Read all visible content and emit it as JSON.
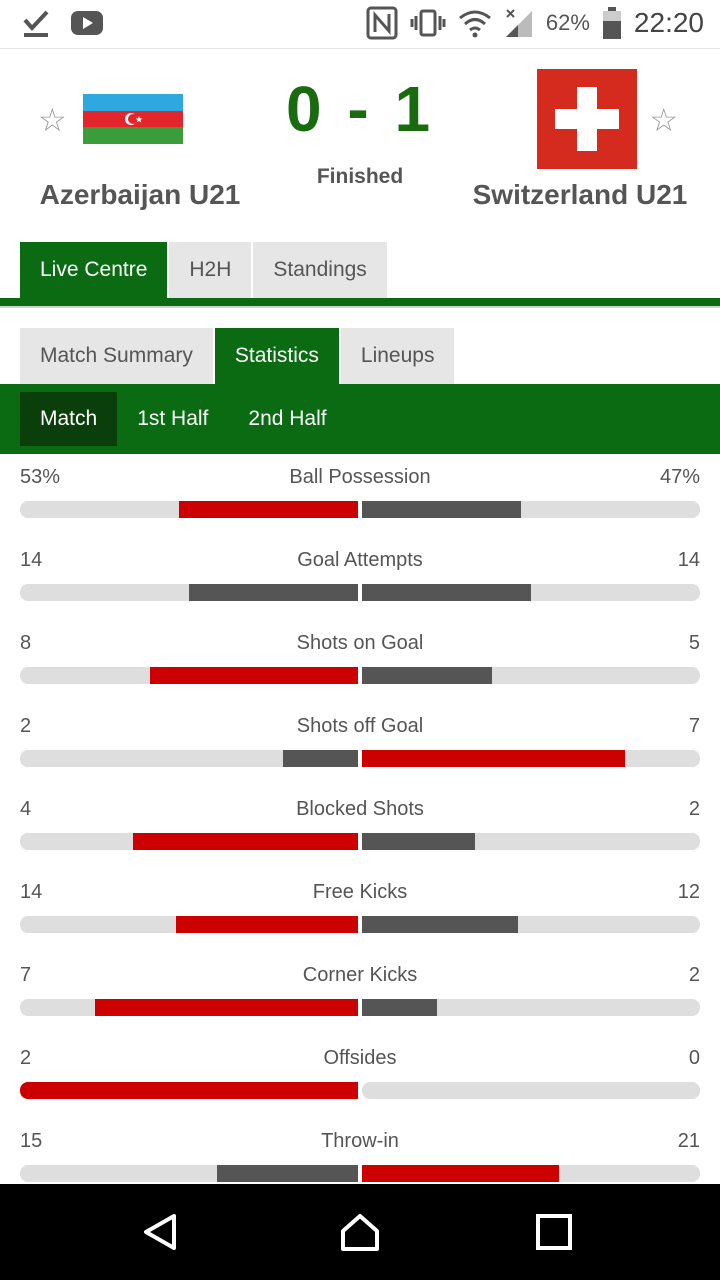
{
  "status_bar": {
    "battery": "62%",
    "time": "22:20"
  },
  "match": {
    "home_team": "Azerbaijan U21",
    "away_team": "Switzerland U21",
    "score": "0 - 1",
    "status": "Finished"
  },
  "main_tabs": [
    {
      "label": "Live Centre",
      "active": true
    },
    {
      "label": "H2H",
      "active": false
    },
    {
      "label": "Standings",
      "active": false
    }
  ],
  "sub_tabs": [
    {
      "label": "Match Summary",
      "active": false
    },
    {
      "label": "Statistics",
      "active": true
    },
    {
      "label": "Lineups",
      "active": false
    }
  ],
  "period_tabs": [
    {
      "label": "Match",
      "active": true
    },
    {
      "label": "1st Half",
      "active": false
    },
    {
      "label": "2nd Half",
      "active": false
    }
  ],
  "colors": {
    "brand_green": "#0a6b12",
    "leader_red": "#cc0000",
    "trailer_gray": "#555555",
    "track_gray": "#dedede"
  },
  "statistics": [
    {
      "label": "Ball Possession",
      "home": "53%",
      "away": "47%",
      "home_value": 53,
      "away_value": 47
    },
    {
      "label": "Goal Attempts",
      "home": "14",
      "away": "14",
      "home_value": 14,
      "away_value": 14
    },
    {
      "label": "Shots on Goal",
      "home": "8",
      "away": "5",
      "home_value": 8,
      "away_value": 5
    },
    {
      "label": "Shots off Goal",
      "home": "2",
      "away": "7",
      "home_value": 2,
      "away_value": 7
    },
    {
      "label": "Blocked Shots",
      "home": "4",
      "away": "2",
      "home_value": 4,
      "away_value": 2
    },
    {
      "label": "Free Kicks",
      "home": "14",
      "away": "12",
      "home_value": 14,
      "away_value": 12
    },
    {
      "label": "Corner Kicks",
      "home": "7",
      "away": "2",
      "home_value": 7,
      "away_value": 2
    },
    {
      "label": "Offsides",
      "home": "2",
      "away": "0",
      "home_value": 2,
      "away_value": 0
    },
    {
      "label": "Throw-in",
      "home": "15",
      "away": "21",
      "home_value": 15,
      "away_value": 21
    }
  ]
}
